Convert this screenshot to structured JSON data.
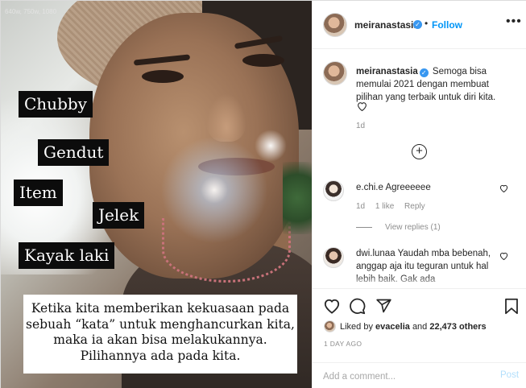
{
  "photo": {
    "resolution_text": "640w, 750w, 1080",
    "labels": [
      "Chubby",
      "Gendut",
      "Item",
      "Jelek",
      "Kayak laki"
    ],
    "quote_lines": [
      "Ketika kita memberikan kekuasaan pada",
      "sebuah “kata” untuk menghancurkan kita,",
      "maka ia akan bisa melakukannya.",
      "Pilihannya ada pada kita."
    ]
  },
  "header": {
    "username": "meiranastasia",
    "separator": "•",
    "follow_label": "Follow",
    "more_label": "•••"
  },
  "caption": {
    "username": "meiranastasia",
    "text": "Semoga bisa memulai 2021 dengan membuat pilihan yang terbaik untuk diri kita.",
    "age": "1d"
  },
  "comments": [
    {
      "username": "e.chi.e",
      "text": "Agreeeeee",
      "age": "1d",
      "likes": "1 like",
      "reply_label": "Reply",
      "view_replies": "View replies (1)"
    },
    {
      "username": "dwi.lunaa",
      "text": "Yaudah mba bebenah, anggap aja itu teguran untuk hal lebih baik. Gak ada"
    }
  ],
  "likes": {
    "prefix": "Liked by",
    "user": "evacelia",
    "middle": "and",
    "count": "22,473 others"
  },
  "timestamp": "1 DAY AGO",
  "comment_box": {
    "placeholder": "Add a comment...",
    "post_label": "Post"
  },
  "colors": {
    "accent": "#0095f6",
    "verified": "#3897f0",
    "muted": "#8e8e8e"
  },
  "icons": [
    "verified-badge-icon",
    "heart-icon",
    "plus-circle-icon",
    "comment-icon",
    "share-icon",
    "bookmark-icon"
  ]
}
